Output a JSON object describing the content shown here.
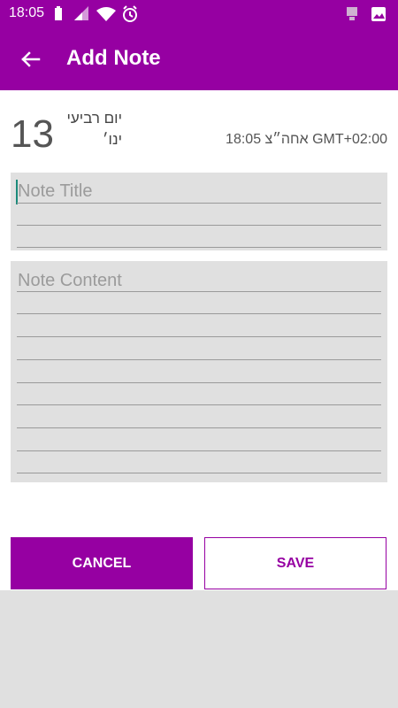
{
  "status_bar": {
    "time": "18:05",
    "icons_left": [
      "battery-icon",
      "signal-icon",
      "wifi-icon",
      "alarm-icon"
    ],
    "icons_right": [
      "notification-icon",
      "image-icon"
    ]
  },
  "app_bar": {
    "title": "Add Note",
    "back_icon": "arrow-left-icon"
  },
  "date": {
    "day": "13",
    "weekday": "יום רביעי",
    "month": "ינו׳",
    "time_zone": "18:05 אחה״צ GMT+02:00"
  },
  "form": {
    "title_placeholder": "Note Title",
    "content_placeholder": "Note Content"
  },
  "buttons": {
    "cancel": "CANCEL",
    "save": "SAVE"
  },
  "colors": {
    "primary": "#9600a2",
    "field_bg": "#e0e0e0",
    "cursor": "#1a8a7a"
  }
}
